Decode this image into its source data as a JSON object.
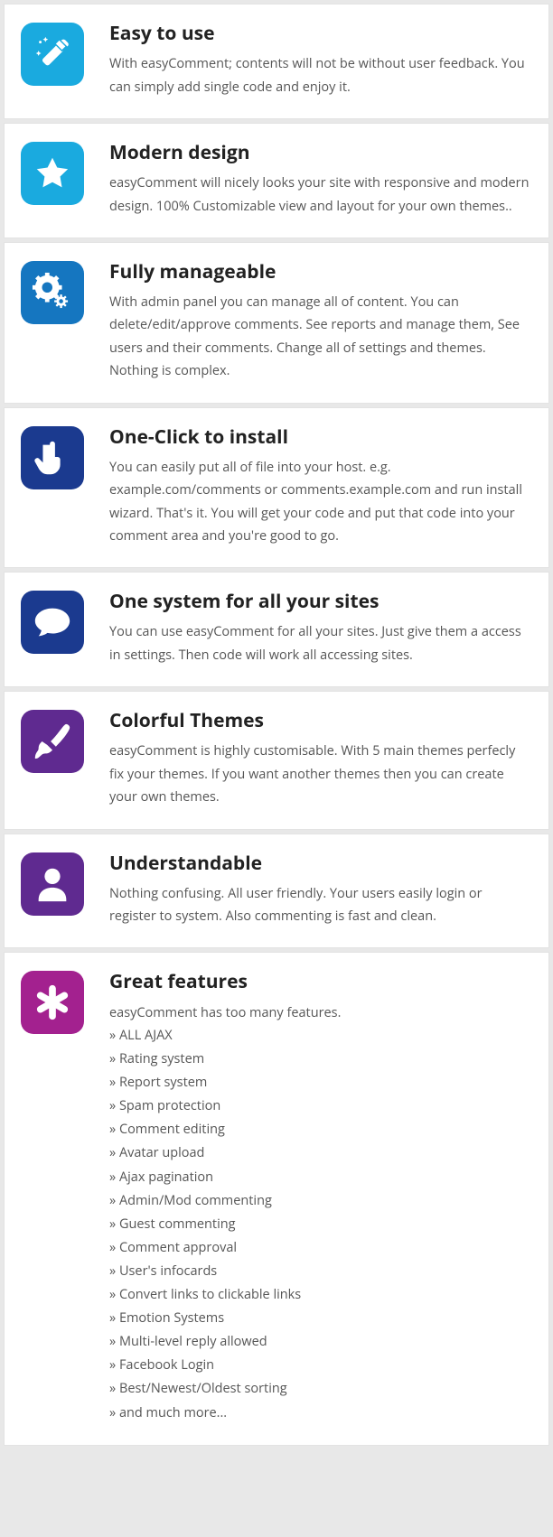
{
  "features": [
    {
      "icon": "wand-icon",
      "color": "bg-lightblue",
      "title": "Easy to use",
      "desc": "With easyComment; contents will not be without user feedback. You can simply add single code and enjoy it."
    },
    {
      "icon": "star-icon",
      "color": "bg-lightblue",
      "title": "Modern design",
      "desc": "easyComment will nicely looks your site with responsive and modern design. 100% Customizable view and layout for your own themes.."
    },
    {
      "icon": "gears-icon",
      "color": "bg-blue",
      "title": "Fully manageable",
      "desc": "With admin panel you can manage all of content. You can delete/edit/approve comments. See reports and manage them, See users and their comments. Change all of settings and themes. Nothing is complex."
    },
    {
      "icon": "hand-icon",
      "color": "bg-darkblue",
      "title": "One-Click to install",
      "desc": "You can easily put all of file into your host. e.g. example.com/comments or comments.example.com and run install wizard. That's it. You will get your code and put that code into your comment area and you're good to go."
    },
    {
      "icon": "speech-icon",
      "color": "bg-darkblue",
      "title": "One system for all your sites",
      "desc": "You can use easyComment for all your sites. Just give them a access in settings. Then code will work all accessing sites."
    },
    {
      "icon": "brush-icon",
      "color": "bg-purple",
      "title": "Colorful Themes",
      "desc": "easyComment is highly customisable. With 5 main themes perfecly fix your themes. If you want another themes then you can create your own themes."
    },
    {
      "icon": "user-icon",
      "color": "bg-purple",
      "title": "Understandable",
      "desc": "Nothing confusing. All user friendly. Your users easily login or register to system. Also commenting is fast and clean."
    },
    {
      "icon": "asterisk-icon",
      "color": "bg-magenta",
      "title": "Great features",
      "desc": "easyComment has too many features.",
      "bullets": [
        "ALL AJAX",
        "Rating system",
        "Report system",
        "Spam protection",
        "Comment editing",
        "Avatar upload",
        "Ajax pagination",
        "Admin/Mod commenting",
        "Guest commenting",
        "Comment approval",
        "User's infocards",
        "Convert links to clickable links",
        "Emotion Systems",
        "Multi-level reply allowed",
        "Facebook Login",
        "Best/Newest/Oldest sorting",
        "and much more..."
      ]
    }
  ]
}
